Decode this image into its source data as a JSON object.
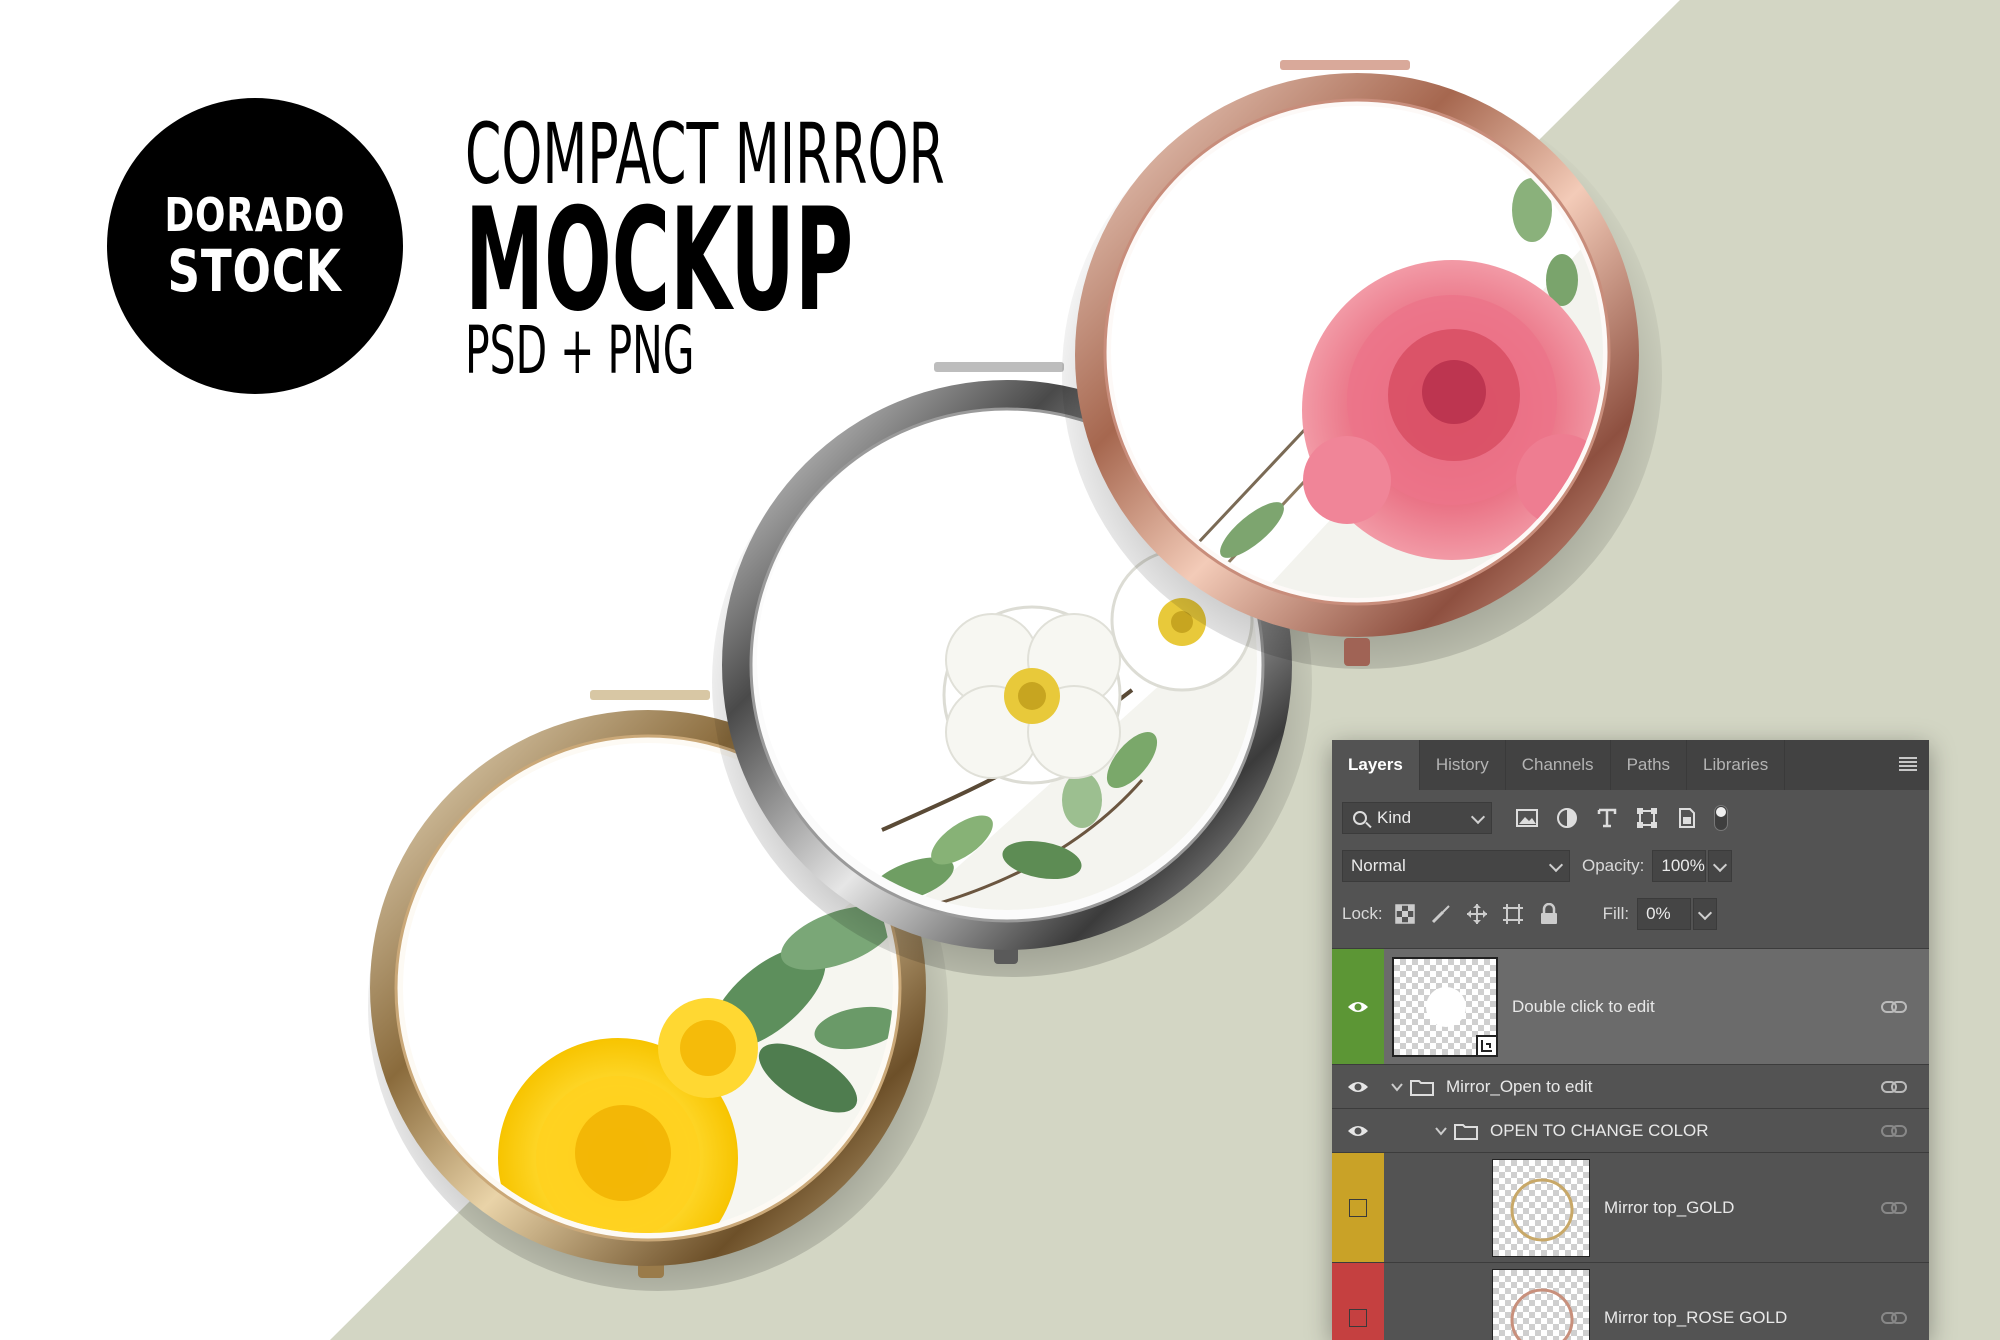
{
  "colors": {
    "background_tri": "#d3d6c4",
    "panel_bg": "#535353",
    "tabs_bg": "#424242",
    "green_tag": "#5c9635",
    "yellow_tag": "#c9a227",
    "red_tag": "#c54040"
  },
  "logo": {
    "line1": "DORADO",
    "line2": "STOCK"
  },
  "title": {
    "line1": "COMPACT MIRROR",
    "line2": "MOCKUP",
    "line3": "PSD + PNG"
  },
  "mirrors": [
    {
      "finish": "gold",
      "flower": "yellow rose"
    },
    {
      "finish": "silver",
      "flower": "white wild rose"
    },
    {
      "finish": "rose gold",
      "flower": "pink rose"
    }
  ],
  "panel": {
    "tabs": [
      "Layers",
      "History",
      "Channels",
      "Paths",
      "Libraries"
    ],
    "active_tab": "Layers",
    "filter": {
      "kind": "Kind"
    },
    "blend_mode": "Normal",
    "opacity_label": "Opacity:",
    "opacity_value": "100%",
    "lock_label": "Lock:",
    "fill_label": "Fill:",
    "fill_value": "0%",
    "layers": [
      {
        "name": "Double click to edit",
        "visible": true,
        "tag": "green",
        "type": "smart-object",
        "selected": true
      },
      {
        "name": "Mirror_Open to edit",
        "visible": true,
        "tag": "none",
        "type": "group"
      },
      {
        "name": "OPEN TO CHANGE COLOR",
        "visible": true,
        "tag": "none",
        "type": "group"
      },
      {
        "name": "Mirror top_GOLD",
        "visible": false,
        "tag": "yellow",
        "type": "layer"
      },
      {
        "name": "Mirror top_ROSE GOLD",
        "visible": false,
        "tag": "red",
        "type": "layer"
      }
    ]
  }
}
